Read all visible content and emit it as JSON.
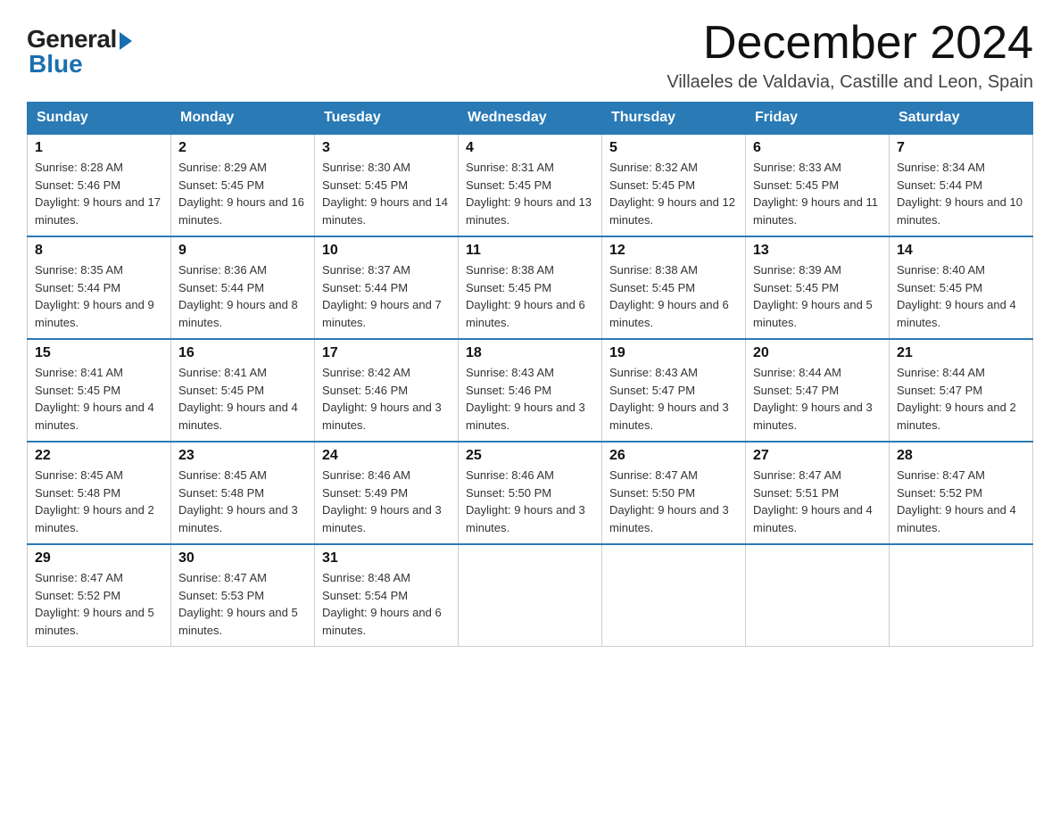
{
  "logo": {
    "general": "General",
    "blue": "Blue"
  },
  "title": "December 2024",
  "subtitle": "Villaeles de Valdavia, Castille and Leon, Spain",
  "weekdays": [
    "Sunday",
    "Monday",
    "Tuesday",
    "Wednesday",
    "Thursday",
    "Friday",
    "Saturday"
  ],
  "weeks": [
    [
      {
        "day": "1",
        "sunrise": "8:28 AM",
        "sunset": "5:46 PM",
        "daylight": "9 hours and 17 minutes."
      },
      {
        "day": "2",
        "sunrise": "8:29 AM",
        "sunset": "5:45 PM",
        "daylight": "9 hours and 16 minutes."
      },
      {
        "day": "3",
        "sunrise": "8:30 AM",
        "sunset": "5:45 PM",
        "daylight": "9 hours and 14 minutes."
      },
      {
        "day": "4",
        "sunrise": "8:31 AM",
        "sunset": "5:45 PM",
        "daylight": "9 hours and 13 minutes."
      },
      {
        "day": "5",
        "sunrise": "8:32 AM",
        "sunset": "5:45 PM",
        "daylight": "9 hours and 12 minutes."
      },
      {
        "day": "6",
        "sunrise": "8:33 AM",
        "sunset": "5:45 PM",
        "daylight": "9 hours and 11 minutes."
      },
      {
        "day": "7",
        "sunrise": "8:34 AM",
        "sunset": "5:44 PM",
        "daylight": "9 hours and 10 minutes."
      }
    ],
    [
      {
        "day": "8",
        "sunrise": "8:35 AM",
        "sunset": "5:44 PM",
        "daylight": "9 hours and 9 minutes."
      },
      {
        "day": "9",
        "sunrise": "8:36 AM",
        "sunset": "5:44 PM",
        "daylight": "9 hours and 8 minutes."
      },
      {
        "day": "10",
        "sunrise": "8:37 AM",
        "sunset": "5:44 PM",
        "daylight": "9 hours and 7 minutes."
      },
      {
        "day": "11",
        "sunrise": "8:38 AM",
        "sunset": "5:45 PM",
        "daylight": "9 hours and 6 minutes."
      },
      {
        "day": "12",
        "sunrise": "8:38 AM",
        "sunset": "5:45 PM",
        "daylight": "9 hours and 6 minutes."
      },
      {
        "day": "13",
        "sunrise": "8:39 AM",
        "sunset": "5:45 PM",
        "daylight": "9 hours and 5 minutes."
      },
      {
        "day": "14",
        "sunrise": "8:40 AM",
        "sunset": "5:45 PM",
        "daylight": "9 hours and 4 minutes."
      }
    ],
    [
      {
        "day": "15",
        "sunrise": "8:41 AM",
        "sunset": "5:45 PM",
        "daylight": "9 hours and 4 minutes."
      },
      {
        "day": "16",
        "sunrise": "8:41 AM",
        "sunset": "5:45 PM",
        "daylight": "9 hours and 4 minutes."
      },
      {
        "day": "17",
        "sunrise": "8:42 AM",
        "sunset": "5:46 PM",
        "daylight": "9 hours and 3 minutes."
      },
      {
        "day": "18",
        "sunrise": "8:43 AM",
        "sunset": "5:46 PM",
        "daylight": "9 hours and 3 minutes."
      },
      {
        "day": "19",
        "sunrise": "8:43 AM",
        "sunset": "5:47 PM",
        "daylight": "9 hours and 3 minutes."
      },
      {
        "day": "20",
        "sunrise": "8:44 AM",
        "sunset": "5:47 PM",
        "daylight": "9 hours and 3 minutes."
      },
      {
        "day": "21",
        "sunrise": "8:44 AM",
        "sunset": "5:47 PM",
        "daylight": "9 hours and 2 minutes."
      }
    ],
    [
      {
        "day": "22",
        "sunrise": "8:45 AM",
        "sunset": "5:48 PM",
        "daylight": "9 hours and 2 minutes."
      },
      {
        "day": "23",
        "sunrise": "8:45 AM",
        "sunset": "5:48 PM",
        "daylight": "9 hours and 3 minutes."
      },
      {
        "day": "24",
        "sunrise": "8:46 AM",
        "sunset": "5:49 PM",
        "daylight": "9 hours and 3 minutes."
      },
      {
        "day": "25",
        "sunrise": "8:46 AM",
        "sunset": "5:50 PM",
        "daylight": "9 hours and 3 minutes."
      },
      {
        "day": "26",
        "sunrise": "8:47 AM",
        "sunset": "5:50 PM",
        "daylight": "9 hours and 3 minutes."
      },
      {
        "day": "27",
        "sunrise": "8:47 AM",
        "sunset": "5:51 PM",
        "daylight": "9 hours and 4 minutes."
      },
      {
        "day": "28",
        "sunrise": "8:47 AM",
        "sunset": "5:52 PM",
        "daylight": "9 hours and 4 minutes."
      }
    ],
    [
      {
        "day": "29",
        "sunrise": "8:47 AM",
        "sunset": "5:52 PM",
        "daylight": "9 hours and 5 minutes."
      },
      {
        "day": "30",
        "sunrise": "8:47 AM",
        "sunset": "5:53 PM",
        "daylight": "9 hours and 5 minutes."
      },
      {
        "day": "31",
        "sunrise": "8:48 AM",
        "sunset": "5:54 PM",
        "daylight": "9 hours and 6 minutes."
      },
      null,
      null,
      null,
      null
    ]
  ]
}
